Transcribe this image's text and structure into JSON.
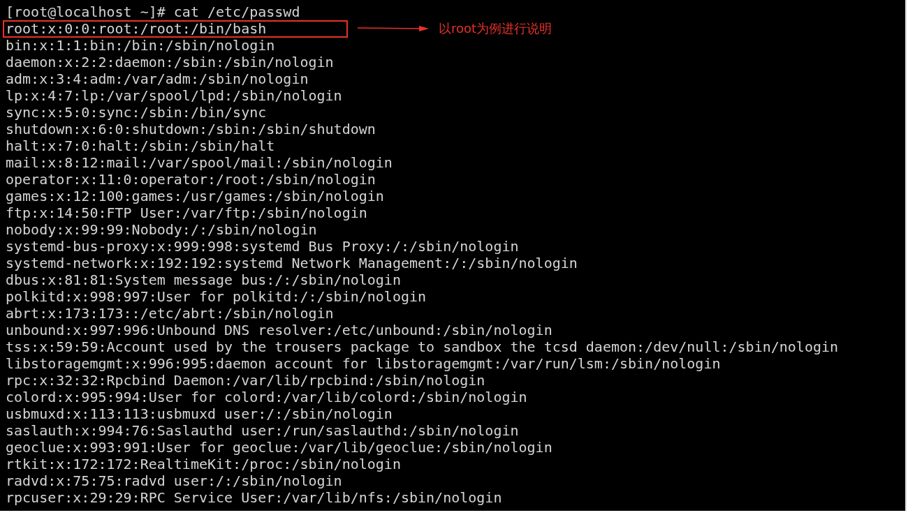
{
  "terminal": {
    "prompt": "[root@localhost ~]# cat /etc/passwd",
    "lines": [
      {
        "text": "root:x:0:0:root:/root:/bin/bash",
        "highlighted": true
      },
      {
        "text": "bin:x:1:1:bin:/bin:/sbin/nologin",
        "highlighted": false
      },
      {
        "text": "daemon:x:2:2:daemon:/sbin:/sbin/nologin",
        "highlighted": false
      },
      {
        "text": "adm:x:3:4:adm:/var/adm:/sbin/nologin",
        "highlighted": false
      },
      {
        "text": "lp:x:4:7:lp:/var/spool/lpd:/sbin/nologin",
        "highlighted": false
      },
      {
        "text": "sync:x:5:0:sync:/sbin:/bin/sync",
        "highlighted": false
      },
      {
        "text": "shutdown:x:6:0:shutdown:/sbin:/sbin/shutdown",
        "highlighted": false
      },
      {
        "text": "halt:x:7:0:halt:/sbin:/sbin/halt",
        "highlighted": false
      },
      {
        "text": "mail:x:8:12:mail:/var/spool/mail:/sbin/nologin",
        "highlighted": false
      },
      {
        "text": "operator:x:11:0:operator:/root:/sbin/nologin",
        "highlighted": false
      },
      {
        "text": "games:x:12:100:games:/usr/games:/sbin/nologin",
        "highlighted": false
      },
      {
        "text": "ftp:x:14:50:FTP User:/var/ftp:/sbin/nologin",
        "highlighted": false
      },
      {
        "text": "nobody:x:99:99:Nobody:/:/sbin/nologin",
        "highlighted": false
      },
      {
        "text": "systemd-bus-proxy:x:999:998:systemd Bus Proxy:/:/sbin/nologin",
        "highlighted": false
      },
      {
        "text": "systemd-network:x:192:192:systemd Network Management:/:/sbin/nologin",
        "highlighted": false
      },
      {
        "text": "dbus:x:81:81:System message bus:/:/sbin/nologin",
        "highlighted": false
      },
      {
        "text": "polkitd:x:998:997:User for polkitd:/:/sbin/nologin",
        "highlighted": false
      },
      {
        "text": "abrt:x:173:173::/etc/abrt:/sbin/nologin",
        "highlighted": false
      },
      {
        "text": "unbound:x:997:996:Unbound DNS resolver:/etc/unbound:/sbin/nologin",
        "highlighted": false
      },
      {
        "text": "tss:x:59:59:Account used by the trousers package to sandbox the tcsd daemon:/dev/null:/sbin/nologin",
        "highlighted": false
      },
      {
        "text": "libstoragemgmt:x:996:995:daemon account for libstoragemgmt:/var/run/lsm:/sbin/nologin",
        "highlighted": false
      },
      {
        "text": "rpc:x:32:32:Rpcbind Daemon:/var/lib/rpcbind:/sbin/nologin",
        "highlighted": false
      },
      {
        "text": "colord:x:995:994:User for colord:/var/lib/colord:/sbin/nologin",
        "highlighted": false
      },
      {
        "text": "usbmuxd:x:113:113:usbmuxd user:/:/sbin/nologin",
        "highlighted": false
      },
      {
        "text": "saslauth:x:994:76:Saslauthd user:/run/saslauthd:/sbin/nologin",
        "highlighted": false
      },
      {
        "text": "geoclue:x:993:991:User for geoclue:/var/lib/geoclue:/sbin/nologin",
        "highlighted": false
      },
      {
        "text": "rtkit:x:172:172:RealtimeKit:/proc:/sbin/nologin",
        "highlighted": false
      },
      {
        "text": "radvd:x:75:75:radvd user:/:/sbin/nologin",
        "highlighted": false
      },
      {
        "text": "rpcuser:x:29:29:RPC Service User:/var/lib/nfs:/sbin/nologin",
        "highlighted": false
      }
    ]
  },
  "annotation": {
    "note": "以root为例进行说明"
  }
}
